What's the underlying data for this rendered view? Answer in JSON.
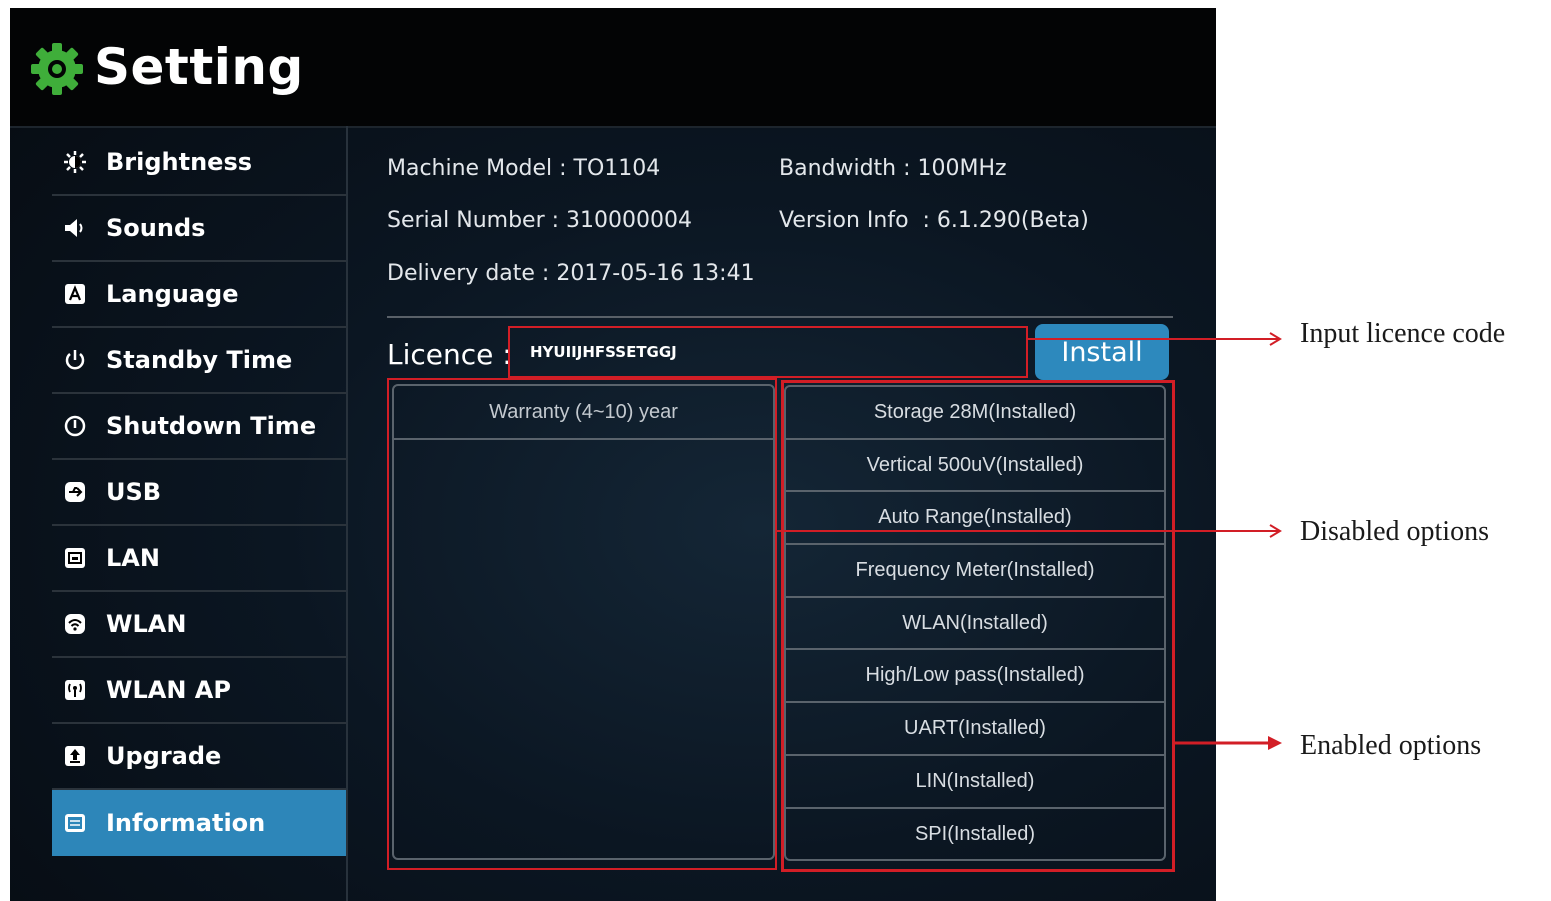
{
  "app": {
    "title": "Setting"
  },
  "sidebar": {
    "items": [
      {
        "label": "Brightness",
        "icon": "brightness-icon"
      },
      {
        "label": "Sounds",
        "icon": "speaker-icon"
      },
      {
        "label": "Language",
        "icon": "language-icon"
      },
      {
        "label": "Standby Time",
        "icon": "power-icon"
      },
      {
        "label": "Shutdown Time",
        "icon": "shutdown-icon"
      },
      {
        "label": "USB",
        "icon": "usb-icon"
      },
      {
        "label": "LAN",
        "icon": "lan-icon"
      },
      {
        "label": "WLAN",
        "icon": "wifi-icon"
      },
      {
        "label": "WLAN AP",
        "icon": "access-point-icon"
      },
      {
        "label": "Upgrade",
        "icon": "upgrade-icon"
      },
      {
        "label": "Information",
        "icon": "information-icon",
        "active": true
      }
    ]
  },
  "info": {
    "machine_model": "Machine Model : TO1104",
    "bandwidth": "Bandwidth : 100MHz",
    "serial_number": "Serial Number : 310000004",
    "version_info": "Version Info  : 6.1.290(Beta)",
    "delivery_date": "Delivery date : 2017-05-16 13:41"
  },
  "licence": {
    "label": "Licence :",
    "value": "HYUIIJHFSSETGGJ",
    "install_label": "Install"
  },
  "warranty": {
    "header": "Warranty (4~10) year"
  },
  "options": [
    "Storage 28M(Installed)",
    "Vertical 500uV(Installed)",
    "Auto Range(Installed)",
    "Frequency Meter(Installed)",
    "WLAN(Installed)",
    "High/Low pass(Installed)",
    "UART(Installed)",
    "LIN(Installed)",
    "SPI(Installed)"
  ],
  "callouts": {
    "input_licence": "Input licence code",
    "disabled_options": "Disabled options",
    "enabled_options": "Enabled options"
  },
  "colors": {
    "accent_blue": "#2d86b9",
    "annotation_red": "#d21e26",
    "logo_green": "#3fae3a"
  }
}
